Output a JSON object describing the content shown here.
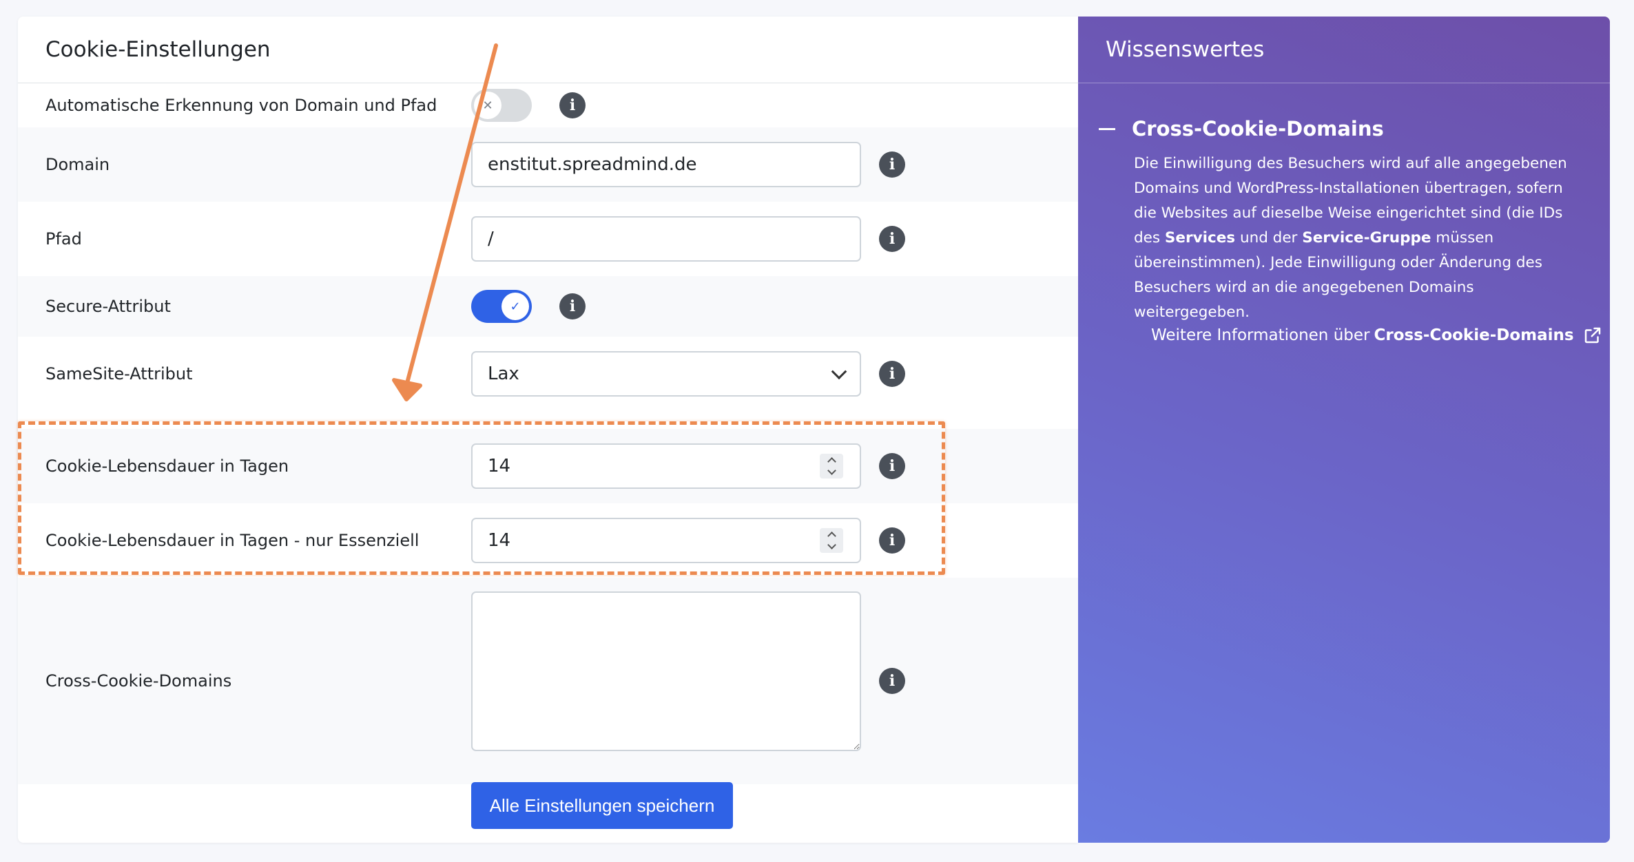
{
  "main": {
    "title": "Cookie-Einstellungen",
    "rows": [
      {
        "label": "Automatische Erkennung von Domain und Pfad",
        "type": "toggle",
        "state": "off"
      },
      {
        "label": "Domain",
        "type": "input",
        "value": "enstitut.spreadmind.de"
      },
      {
        "label": "Pfad",
        "type": "input",
        "value": "/"
      },
      {
        "label": "Secure-Attribut",
        "type": "toggle",
        "state": "on"
      },
      {
        "label": "SameSite-Attribut",
        "type": "select",
        "value": "Lax"
      },
      {
        "label": "Cookie-Lebensdauer in Tagen",
        "type": "number",
        "value": "14"
      },
      {
        "label": "Cookie-Lebensdauer in Tagen - nur Essenziell",
        "type": "number",
        "value": "14"
      },
      {
        "label": "Cross-Cookie-Domains",
        "type": "textarea",
        "value": ""
      }
    ],
    "save_label": "Alle Einstellungen speichern"
  },
  "sidebar": {
    "title": "Wissenswertes",
    "section_title": "Cross-Cookie-Domains",
    "text_1": "Die Einwilligung des Besuchers wird auf alle angegebenen Domains und WordPress-Installationen übertragen, sofern die Websites auf dieselbe Weise eingerichtet sind (die IDs des ",
    "text_bold_1": "Services",
    "text_2": " und der ",
    "text_bold_2": "Service-Gruppe",
    "text_3": " müssen übereinstimmen). Jede Einwilligung oder Änderung des Besuchers wird an die angegebenen Domains weitergegeben.",
    "link_prefix": "Weitere Informationen über",
    "link_bold": "Cross-Cookie-Domains"
  },
  "icons": {
    "info": "info-icon",
    "toggle_off": "x-icon",
    "toggle_on": "check-icon",
    "external": "external-link-icon"
  },
  "colors": {
    "accent": "#2f62e6",
    "highlight": "#ec8a50",
    "sidebar_gradient_start": "#6d4fa9",
    "sidebar_gradient_end": "#6a7ce1"
  }
}
